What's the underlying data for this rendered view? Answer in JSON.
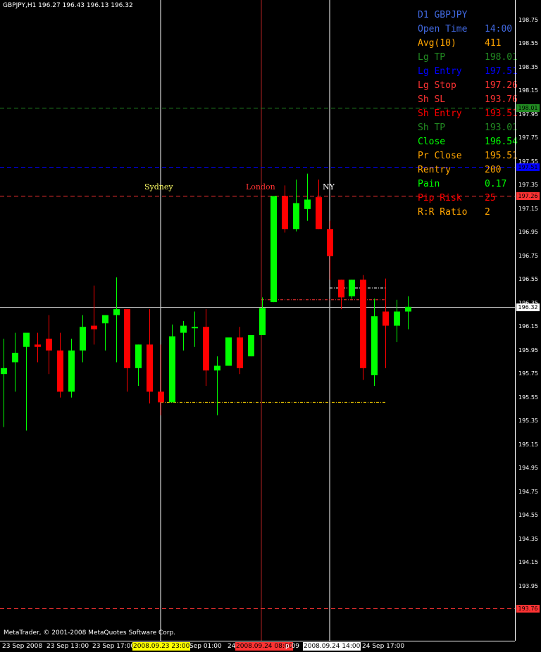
{
  "header": {
    "symbol_text": "GBPJPY,H1  196.27 196.43 196.13 196.32"
  },
  "copyright": "MetaTrader, © 2001-2008 MetaQuotes Software Corp.",
  "sessions": [
    {
      "name": "Sydney",
      "color": "#ffff66"
    },
    {
      "name": "London",
      "color": "#ff3333"
    },
    {
      "name": "NY",
      "color": "#ffffff"
    }
  ],
  "info_panel": [
    {
      "label": "D1 GBPJPY",
      "value": "",
      "color": "#4169e1"
    },
    {
      "label": "Open Time",
      "value": "14:00",
      "color": "#4169e1"
    },
    {
      "label": "Avg(10)",
      "value": "411",
      "color": "#ffa500"
    },
    {
      "label": "Lg TP",
      "value": "198.01",
      "color": "#228b22"
    },
    {
      "label": "Lg Entry",
      "value": "197.51",
      "color": "#0000ff"
    },
    {
      "label": "Lg Stop",
      "value": "197.26",
      "color": "#ff3333"
    },
    {
      "label": "Sh SL",
      "value": "193.76",
      "color": "#ff3333"
    },
    {
      "label": "Sh Entry",
      "value": "193.51",
      "color": "#ff0000"
    },
    {
      "label": "Sh TP",
      "value": "193.01",
      "color": "#228b22"
    },
    {
      "label": "Close",
      "value": "196.54",
      "color": "#00ff00"
    },
    {
      "label": "Pr Close",
      "value": "195.51",
      "color": "#ffa500"
    },
    {
      "label": "Rentry",
      "value": "200",
      "color": "#ffa500"
    },
    {
      "label": "Pain",
      "value": "0.17",
      "color": "#00ff00"
    },
    {
      "label": "Pip Risk",
      "value": "25",
      "color": "#ff0000"
    },
    {
      "label": "R:R Ratio",
      "value": "2",
      "color": "#ffa500"
    }
  ],
  "price_axis": {
    "ticks": [
      "198.75",
      "198.55",
      "198.35",
      "198.15",
      "197.95",
      "197.75",
      "197.55",
      "197.35",
      "197.15",
      "196.95",
      "196.75",
      "196.55",
      "196.35",
      "196.15",
      "195.95",
      "195.75",
      "195.55",
      "195.35",
      "195.15",
      "194.95",
      "194.75",
      "194.55",
      "194.35",
      "194.15",
      "193.95",
      "193.75"
    ],
    "badges": [
      {
        "text": "198.01",
        "bg": "#228b22",
        "fg": "#000000"
      },
      {
        "text": "197.51",
        "bg": "#0000ff",
        "fg": "#000000"
      },
      {
        "text": "197.26",
        "bg": "#ff3333",
        "fg": "#000000"
      },
      {
        "text": "196.32",
        "bg": "#ffffff",
        "fg": "#000000"
      },
      {
        "text": "193.76",
        "bg": "#ff3333",
        "fg": "#000000"
      }
    ]
  },
  "time_axis": [
    {
      "text": "23 Sep 2008",
      "bg": "",
      "fg": "#ffffff"
    },
    {
      "text": "23 Sep 13:00",
      "bg": "",
      "fg": "#ffffff"
    },
    {
      "text": "23 Sep 17:00",
      "bg": "",
      "fg": "#ffffff"
    },
    {
      "text": "2008.09.23 23:00",
      "bg": "#ffff00",
      "fg": "#000000"
    },
    {
      "text": "Sep 01:00",
      "bg": "",
      "fg": "#ffffff"
    },
    {
      "text": "24",
      "bg": "",
      "fg": "#ffffff"
    },
    {
      "text": "2008.09.24 08:00",
      "bg": "#ff3333",
      "fg": "#000000"
    },
    {
      "text": "p 09",
      "bg": "",
      "fg": "#ffffff"
    },
    {
      "text": "2008.09.24 14:00",
      "bg": "#ffffff",
      "fg": "#000000"
    },
    {
      "text": "24 Sep 17:00",
      "bg": "",
      "fg": "#ffffff"
    }
  ],
  "chart_data": {
    "type": "candlestick",
    "symbol": "GBPJPY",
    "timeframe": "H1",
    "up_color": "#00ff00",
    "down_color": "#ff0000",
    "ylim": [
      193.65,
      198.85
    ],
    "candles": [
      {
        "o": 195.75,
        "h": 196.05,
        "l": 195.3,
        "c": 195.8
      },
      {
        "o": 195.85,
        "h": 196.1,
        "l": 195.6,
        "c": 195.93
      },
      {
        "o": 195.98,
        "h": 196.07,
        "l": 195.27,
        "c": 196.1
      },
      {
        "o": 196.0,
        "h": 196.1,
        "l": 195.85,
        "c": 195.98
      },
      {
        "o": 196.05,
        "h": 196.25,
        "l": 195.75,
        "c": 195.95
      },
      {
        "o": 195.95,
        "h": 196.1,
        "l": 195.55,
        "c": 195.6
      },
      {
        "o": 195.6,
        "h": 196.05,
        "l": 195.55,
        "c": 195.95
      },
      {
        "o": 195.95,
        "h": 196.25,
        "l": 195.85,
        "c": 196.15
      },
      {
        "o": 196.16,
        "h": 196.5,
        "l": 196.0,
        "c": 196.13
      },
      {
        "o": 196.18,
        "h": 196.25,
        "l": 195.95,
        "c": 196.25
      },
      {
        "o": 196.25,
        "h": 196.57,
        "l": 195.85,
        "c": 196.3
      },
      {
        "o": 196.3,
        "h": 196.3,
        "l": 195.6,
        "c": 195.8
      },
      {
        "o": 195.8,
        "h": 196.0,
        "l": 195.65,
        "c": 196.0
      },
      {
        "o": 196.0,
        "h": 196.3,
        "l": 195.5,
        "c": 195.6
      },
      {
        "o": 195.6,
        "h": 196.0,
        "l": 195.4,
        "c": 195.51
      },
      {
        "o": 195.51,
        "h": 196.17,
        "l": 195.51,
        "c": 196.07
      },
      {
        "o": 196.1,
        "h": 196.2,
        "l": 195.95,
        "c": 196.16
      },
      {
        "o": 196.15,
        "h": 196.28,
        "l": 195.98,
        "c": 196.15
      },
      {
        "o": 196.15,
        "h": 196.3,
        "l": 195.65,
        "c": 195.78
      },
      {
        "o": 195.78,
        "h": 195.9,
        "l": 195.4,
        "c": 195.82
      },
      {
        "o": 195.82,
        "h": 196.0,
        "l": 195.82,
        "c": 196.06
      },
      {
        "o": 196.06,
        "h": 196.15,
        "l": 195.75,
        "c": 195.8
      },
      {
        "o": 195.9,
        "h": 196.03,
        "l": 195.9,
        "c": 196.08
      },
      {
        "o": 196.08,
        "h": 196.4,
        "l": 196.08,
        "c": 196.31
      },
      {
        "o": 196.36,
        "h": 196.9,
        "l": 196.36,
        "c": 197.26
      },
      {
        "o": 197.26,
        "h": 197.35,
        "l": 196.95,
        "c": 196.98
      },
      {
        "o": 196.98,
        "h": 197.4,
        "l": 196.96,
        "c": 197.2
      },
      {
        "o": 197.15,
        "h": 197.45,
        "l": 197.05,
        "c": 197.23
      },
      {
        "o": 197.25,
        "h": 197.4,
        "l": 196.98,
        "c": 196.98
      },
      {
        "o": 196.98,
        "h": 197.05,
        "l": 196.55,
        "c": 196.75
      },
      {
        "o": 196.55,
        "h": 196.55,
        "l": 196.3,
        "c": 196.4
      },
      {
        "o": 196.41,
        "h": 196.55,
        "l": 196.39,
        "c": 196.55
      },
      {
        "o": 196.55,
        "h": 196.59,
        "l": 195.7,
        "c": 195.8
      },
      {
        "o": 195.74,
        "h": 196.39,
        "l": 195.65,
        "c": 196.24
      },
      {
        "o": 196.28,
        "h": 196.56,
        "l": 195.8,
        "c": 196.16
      },
      {
        "o": 196.16,
        "h": 196.38,
        "l": 196.02,
        "c": 196.28
      },
      {
        "o": 196.28,
        "h": 196.41,
        "l": 196.13,
        "c": 196.32
      }
    ],
    "horizontal_lines": [
      {
        "name": "Lg TP",
        "price": 198.01,
        "color": "#228b22",
        "style": "dashed"
      },
      {
        "name": "Lg Entry",
        "price": 197.51,
        "color": "#0000ff",
        "style": "dashed"
      },
      {
        "name": "Lg Stop",
        "price": 197.26,
        "color": "#ff3333",
        "style": "dashed"
      },
      {
        "name": "Bid",
        "price": 196.32,
        "color": "#c0c0c0",
        "style": "solid"
      },
      {
        "name": "Sh SL",
        "price": 193.76,
        "color": "#ff3333",
        "style": "dashed"
      }
    ],
    "sessions": [
      "Sydney",
      "London",
      "NY"
    ]
  }
}
